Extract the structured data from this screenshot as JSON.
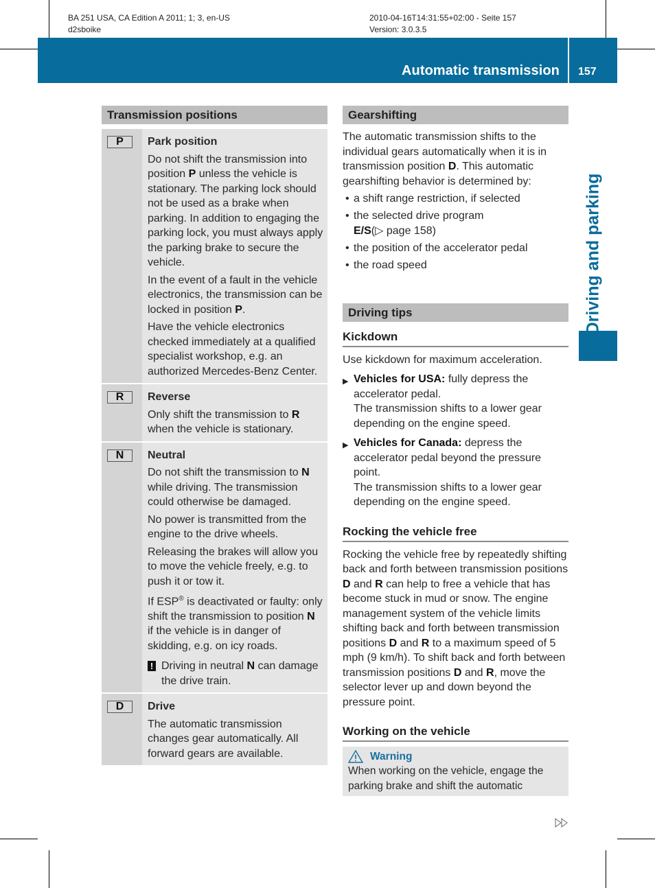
{
  "meta": {
    "left_line1": "BA 251 USA, CA Edition A 2011; 1; 3, en-US",
    "left_line2": "d2sboike",
    "right_line1": "2010-04-16T14:31:55+02:00 - Seite 157",
    "right_line2": "Version: 3.0.3.5"
  },
  "header": {
    "title": "Automatic transmission",
    "page_number": "157",
    "side_label": "Driving and parking",
    "brand_color": "#086d9c"
  },
  "transmission_positions": {
    "heading": "Transmission positions",
    "rows": [
      {
        "key": "P",
        "title": "Park position",
        "paragraphs": [
          [
            "Do not shift the transmission into position ",
            "P",
            " unless the vehicle is stationary. The parking lock should not be used as a brake when parking. In addition to engaging the parking lock, you must always apply the parking brake to secure the vehicle."
          ],
          [
            "In the event of a fault in the vehicle electronics, the transmission can be locked in position ",
            "P",
            "."
          ],
          [
            "Have the vehicle electronics checked immediately at a qualified specialist workshop, e.g. an authorized Mercedes-Benz Center.",
            "",
            ""
          ]
        ]
      },
      {
        "key": "R",
        "title": "Reverse",
        "paragraphs": [
          [
            "Only shift the transmission to ",
            "R",
            " when the vehicle is stationary."
          ]
        ]
      },
      {
        "key": "N",
        "title": "Neutral",
        "paragraphs": [
          [
            "Do not shift the transmission to ",
            "N",
            " while driving. The transmission could otherwise be damaged."
          ],
          [
            "No power is transmitted from the engine to the drive wheels.",
            "",
            ""
          ],
          [
            "Releasing the brakes will allow you to move the vehicle freely, e.g. to push it or tow it.",
            "",
            ""
          ]
        ],
        "esp_paragraph": {
          "pre": "If ESP",
          "sup": "®",
          "mid": " is deactivated or faulty: only shift the transmission to position ",
          "bold": "N",
          "post": " if the vehicle is in danger of skidding, e.g. on icy roads."
        },
        "note": {
          "icon": "exclamation-icon",
          "pre": "Driving in neutral ",
          "bold": "N",
          "post": " can damage the drive train."
        }
      },
      {
        "key": "D",
        "title": "Drive",
        "paragraphs": [
          [
            "The automatic transmission changes gear automatically. All forward gears are available.",
            "",
            ""
          ]
        ]
      }
    ]
  },
  "gearshifting": {
    "heading": "Gearshifting",
    "intro_pre": "The automatic transmission shifts to the individual gears automatically when it is in transmission position ",
    "intro_bold": "D",
    "intro_post": ". This automatic gearshifting behavior is determined by:",
    "bullets": [
      "a shift range restriction, if selected",
      "the selected drive program",
      "the position of the accelerator pedal",
      "the road speed"
    ],
    "drive_program_ref_bold": "E/S",
    "drive_program_ref_text": "(▷ page 158)"
  },
  "driving_tips": {
    "heading": "Driving tips",
    "kickdown": {
      "heading": "Kickdown",
      "intro": "Use kickdown for maximum acceleration.",
      "items": [
        {
          "bold": "Vehicles for USA:",
          "text": " fully depress the accelerator pedal.",
          "result": "The transmission shifts to a lower gear depending on the engine speed."
        },
        {
          "bold": "Vehicles for Canada:",
          "text": " depress the accelerator pedal beyond the pressure point.",
          "result": "The transmission shifts to a lower gear depending on the engine speed."
        }
      ]
    },
    "rocking": {
      "heading": "Rocking the vehicle free",
      "t1": "Rocking the vehicle free by repeatedly shifting back and forth between transmission positions ",
      "b1": "D",
      "t2": " and ",
      "b2": "R",
      "t3": " can help to free a vehicle that has become stuck in mud or snow. The engine management system of the vehicle limits shifting back and forth between transmission positions ",
      "b3": "D",
      "t4": " and ",
      "b4": "R",
      "t5": " to a maximum speed of 5 mph (9 km/h). To shift back and forth between transmission positions ",
      "b5": "D",
      "t6": " and ",
      "b6": "R",
      "t7": ", move the selector lever up and down beyond the pressure point."
    },
    "working": {
      "heading": "Working on the vehicle",
      "warning_label": "Warning",
      "warning_text": "When working on the vehicle, engage the parking brake and shift the automatic",
      "warning_color": "#1a6fa0"
    }
  },
  "footer": {
    "continue_icon": "double-triangle-right-icon"
  }
}
